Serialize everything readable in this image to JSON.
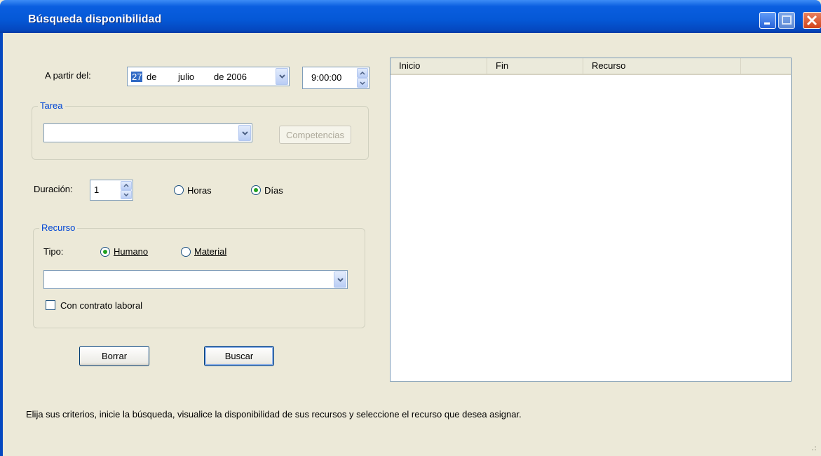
{
  "window": {
    "title": "Búsqueda disponibilidad"
  },
  "start": {
    "label": "A partir del:",
    "day": "27",
    "day_suffix": "de",
    "month": "julio",
    "year": "de 2006",
    "time": "9:00:00"
  },
  "task": {
    "group_title": "Tarea",
    "select_value": "",
    "competencias_label": "Competencias"
  },
  "duration": {
    "label": "Duración:",
    "value": "1",
    "unit_hours": "Horas",
    "unit_days": "Días",
    "selected_unit": "Días"
  },
  "resource": {
    "group_title": "Recurso",
    "type_label": "Tipo:",
    "type_human": "Humano",
    "type_material": "Material",
    "selected_type": "Humano",
    "select_value": "",
    "contract_label": "Con contrato laboral",
    "contract_checked": false
  },
  "buttons": {
    "clear": "Borrar",
    "search": "Buscar"
  },
  "results": {
    "columns": [
      "Inicio",
      "Fin",
      "Recurso",
      ""
    ],
    "rows": []
  },
  "footer": {
    "hint": "Elija sus criterios, inicie la búsqueda, visualice la disponibilidad de sus recursos y seleccione el recurso que desea asignar."
  },
  "colors": {
    "title_bar": "#0558d6",
    "group_title": "#0046d5",
    "window_bg": "#ece9d8"
  },
  "icons": [
    "minimize-icon",
    "maximize-icon",
    "close-icon",
    "chevron-down-icon",
    "spin-up-icon",
    "spin-down-icon",
    "resize-grip-icon"
  ]
}
